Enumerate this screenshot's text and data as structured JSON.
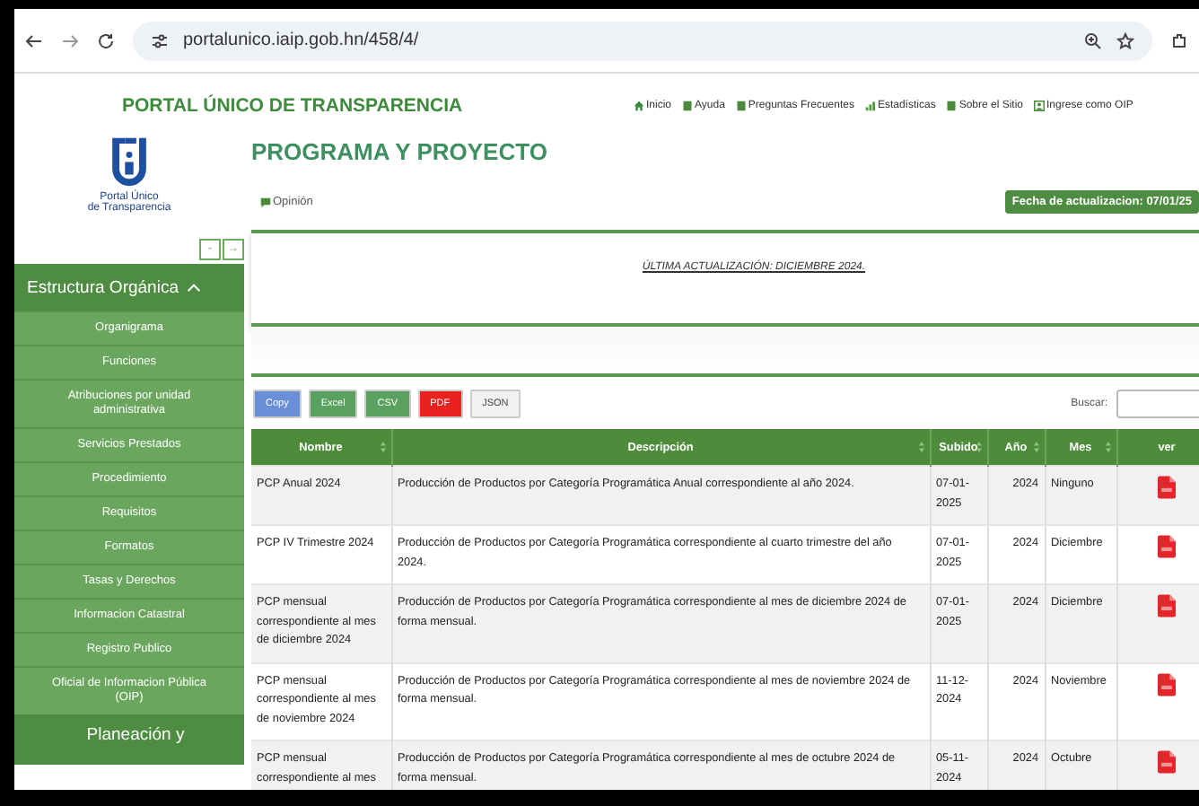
{
  "browser": {
    "url": "portalunico.iaip.gob.hn/458/4/"
  },
  "header": {
    "site_title": "PORTAL ÚNICO DE TRANSPARENCIA",
    "nav": [
      "Inicio",
      "Ayuda",
      "Preguntas Frecuentes",
      "Estadísticas",
      "Sobre el Sitio",
      "Ingrese como OIP"
    ]
  },
  "logo": {
    "caption_1": "Portal Único",
    "caption_2": "de Transparencia"
  },
  "sidebar": {
    "collapse_buttons": [
      "-",
      "→"
    ],
    "section": "Estructura Orgánica",
    "expanded": true,
    "items": [
      "Organigrama",
      "Funciones",
      "Atribuciones por unidad administrativa",
      "Servicios Prestados",
      "Procedimiento",
      "Requisitos",
      "Formatos",
      "Tasas y Derechos",
      "Informacion Catastral",
      "Registro Publico",
      "Oficial de Informacion Pública (OIP)"
    ],
    "next_section": "Planeación y"
  },
  "main": {
    "title": "PROGRAMA Y PROYECTO",
    "opinion": "Opinión",
    "update_badge": "Fecha de actualizacion: 07/01/25",
    "notice": "ÚLTIMA ACTUALIZACIÓN: DICIEMBRE 2024."
  },
  "export_buttons": [
    {
      "label": "Copy",
      "color": "#6a8fd8"
    },
    {
      "label": "Excel",
      "color": "#5aa05e"
    },
    {
      "label": "CSV",
      "color": "#5aa05e"
    },
    {
      "label": "PDF",
      "color": "#e8231f"
    },
    {
      "label": "JSON",
      "color": "#f2f2f2"
    }
  ],
  "search": {
    "label": "Buscar:"
  },
  "table": {
    "columns": [
      "Nombre",
      "Descripción",
      "Subido",
      "Año",
      "Mes",
      "ver"
    ],
    "rows": [
      {
        "name": "PCP Anual 2024",
        "description": "Producción de Productos por Categoría Programática Anual correspondiente al año 2024.",
        "uploaded": "07-01-2025",
        "year": "2024",
        "month": "Ninguno"
      },
      {
        "name": "PCP IV Trimestre 2024",
        "description": "Producción de Productos por Categoría Programática correspondiente al cuarto trimestre del año 2024.",
        "uploaded": "07-01-2025",
        "year": "2024",
        "month": "Diciembre"
      },
      {
        "name": "PCP mensual correspondiente al mes de diciembre 2024",
        "description": "Producción de Productos por Categoría Programática correspondiente al mes de diciembre 2024 de forma mensual.",
        "uploaded": "07-01-2025",
        "year": "2024",
        "month": "Diciembre"
      },
      {
        "name": "PCP mensual correspondiente al mes de noviembre 2024",
        "description": "Producción de Productos por Categoría Programática correspondiente al mes de noviembre 2024 de forma mensual.",
        "uploaded": "11-12-2024",
        "year": "2024",
        "month": "Noviembre"
      },
      {
        "name": "PCP mensual correspondiente al mes",
        "description": "Producción de Productos por Categoría Programática correspondiente al mes de octubre 2024 de forma mensual.",
        "uploaded": "05-11-2024",
        "year": "2024",
        "month": "Octubre"
      }
    ]
  }
}
